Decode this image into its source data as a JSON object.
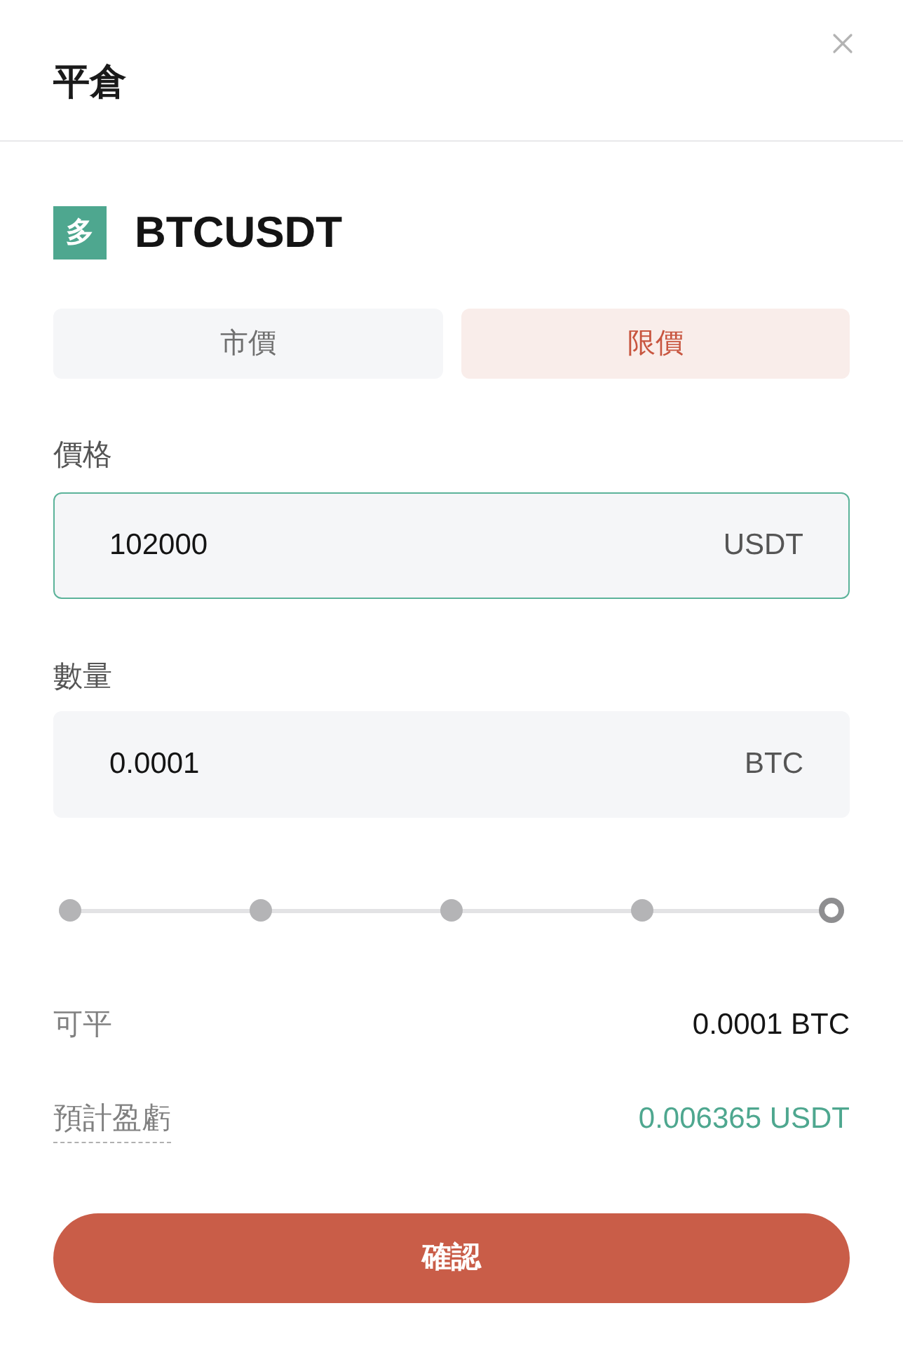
{
  "dialog": {
    "title": "平倉"
  },
  "position": {
    "side_badge": "多",
    "symbol": "BTCUSDT"
  },
  "order_type_tabs": [
    {
      "label": "市價",
      "selected": false
    },
    {
      "label": "限價",
      "selected": true
    }
  ],
  "fields": [
    {
      "label": "價格",
      "value": "102000",
      "unit": "USDT",
      "focused": true
    },
    {
      "label": "數量",
      "value": "0.0001",
      "unit": "BTC",
      "focused": false
    }
  ],
  "slider": {
    "level": 1
  },
  "summary": [
    {
      "label": "可平",
      "value": "0.0001 BTC",
      "kind": "plain"
    },
    {
      "label": "預計盈虧",
      "value": "0.006365 USDT",
      "kind": "pnl"
    }
  ],
  "confirm_button": "確認"
}
